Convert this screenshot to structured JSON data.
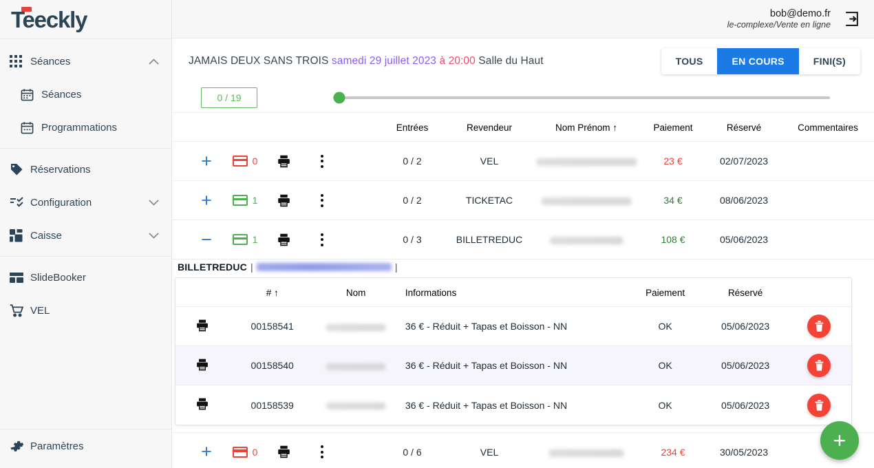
{
  "brand": {
    "name": "Teeckly",
    "accent_color": "#e8413c",
    "text_color": "#2b4558"
  },
  "topbar": {
    "user_email": "bob@demo.fr",
    "user_org": "le-complexe/Vente en ligne",
    "logout_icon": "logout-icon"
  },
  "sidebar": {
    "items": [
      {
        "label": "Séances",
        "icon": "grid-icon",
        "chevron": "chevron-up-icon",
        "level": "parent"
      },
      {
        "label": "Séances",
        "icon": "calendar-icon",
        "chevron": "",
        "level": "child"
      },
      {
        "label": "Programmations",
        "icon": "calendar-dots-icon",
        "chevron": "",
        "level": "child"
      },
      {
        "label": "Réservations",
        "icon": "tag-icon",
        "chevron": "",
        "level": "parent"
      },
      {
        "label": "Configuration",
        "icon": "checklist-icon",
        "chevron": "chevron-down-icon",
        "level": "parent"
      },
      {
        "label": "Caisse",
        "icon": "dashboard-icon",
        "chevron": "chevron-down-icon",
        "level": "parent"
      },
      {
        "label": "SlideBooker",
        "icon": "layout-icon",
        "chevron": "",
        "level": "parent"
      },
      {
        "label": "VEL",
        "icon": "cart-icon",
        "chevron": "",
        "level": "parent"
      }
    ],
    "footer": {
      "label": "Paramètres",
      "icon": "gear-icon"
    }
  },
  "session": {
    "title_name": "JAMAIS DEUX SANS TROIS",
    "title_date": "samedi 29 juillet 2023",
    "title_time": "à 20:00",
    "title_room": "Salle du Haut",
    "date_color": "#8b5cf6",
    "time_color": "#ef4a72"
  },
  "filters": {
    "tabs": [
      {
        "label": "TOUS",
        "active": false
      },
      {
        "label": "EN COURS",
        "active": true
      },
      {
        "label": "FINI(S)",
        "active": false
      }
    ],
    "active_color": "#1b7ae4"
  },
  "progress": {
    "count_label": "0 / 19",
    "count_color": "#5cb85c",
    "slider_value": 0,
    "slider_thumb_color": "#4caf50"
  },
  "main_table": {
    "headers": [
      "",
      "Entrées",
      "Revendeur",
      "Nom Prénom ↑",
      "Paiement",
      "Réservé",
      "Commentaires"
    ],
    "rows": [
      {
        "toggle": "+",
        "card_count": "0",
        "card_color": "#f04134",
        "print_icon": "printer-icon",
        "more_icon": "more-vertical-icon",
        "entrees": "0 / 2",
        "revendeur": "VEL",
        "nom": "",
        "nom_redacted": true,
        "paiement": "23 €",
        "paiement_color": "#f04134",
        "reserve": "02/07/2023",
        "commentaires": ""
      },
      {
        "toggle": "+",
        "card_count": "1",
        "card_color": "#4caf50",
        "print_icon": "printer-icon",
        "more_icon": "more-vertical-icon",
        "entrees": "0 / 2",
        "revendeur": "TICKETAC",
        "nom": "",
        "nom_redacted": true,
        "paiement": "34 €",
        "paiement_color": "#2e7d32",
        "reserve": "08/06/2023",
        "commentaires": ""
      },
      {
        "toggle": "−",
        "card_count": "1",
        "card_color": "#4caf50",
        "print_icon": "printer-icon",
        "more_icon": "more-vertical-icon",
        "entrees": "0 / 3",
        "revendeur": "BILLETREDUC",
        "nom": "",
        "nom_redacted": true,
        "paiement": "108 €",
        "paiement_color": "#2e7d32",
        "reserve": "05/06/2023",
        "commentaires": ""
      },
      {
        "toggle": "+",
        "card_count": "0",
        "card_color": "#f04134",
        "print_icon": "printer-icon",
        "more_icon": "more-vertical-icon",
        "entrees": "0 / 6",
        "revendeur": "VEL",
        "nom": "",
        "nom_redacted": true,
        "paiement": "234 €",
        "paiement_color": "#f04134",
        "reserve": "30/05/2023",
        "commentaires": ""
      }
    ]
  },
  "sub_panel": {
    "reseller": "BILLETREDUC",
    "separator": "|",
    "email_redacted": true,
    "headers": [
      "",
      "# ↑",
      "Nom",
      "Informations",
      "Paiement",
      "Réservé",
      ""
    ],
    "rows": [
      {
        "print_icon": "printer-icon",
        "number": "00158541",
        "nom": "",
        "nom_redacted": true,
        "informations": "36 € - Réduit + Tapas et Boisson - NN",
        "paiement": "OK",
        "reserve": "05/06/2023",
        "delete_icon": "trash-icon",
        "highlighted": false
      },
      {
        "print_icon": "printer-icon",
        "number": "00158540",
        "nom": "",
        "nom_redacted": true,
        "informations": "36 € - Réduit + Tapas et Boisson - NN",
        "paiement": "OK",
        "reserve": "05/06/2023",
        "delete_icon": "trash-icon",
        "highlighted": true
      },
      {
        "print_icon": "printer-icon",
        "number": "00158539",
        "nom": "",
        "nom_redacted": true,
        "informations": "36 € - Réduit + Tapas et Boisson - NN",
        "paiement": "OK",
        "reserve": "05/06/2023",
        "delete_icon": "trash-icon",
        "highlighted": false
      }
    ]
  },
  "fab": {
    "label": "+",
    "color": "#4caf50",
    "name": "add-reservation-button"
  }
}
